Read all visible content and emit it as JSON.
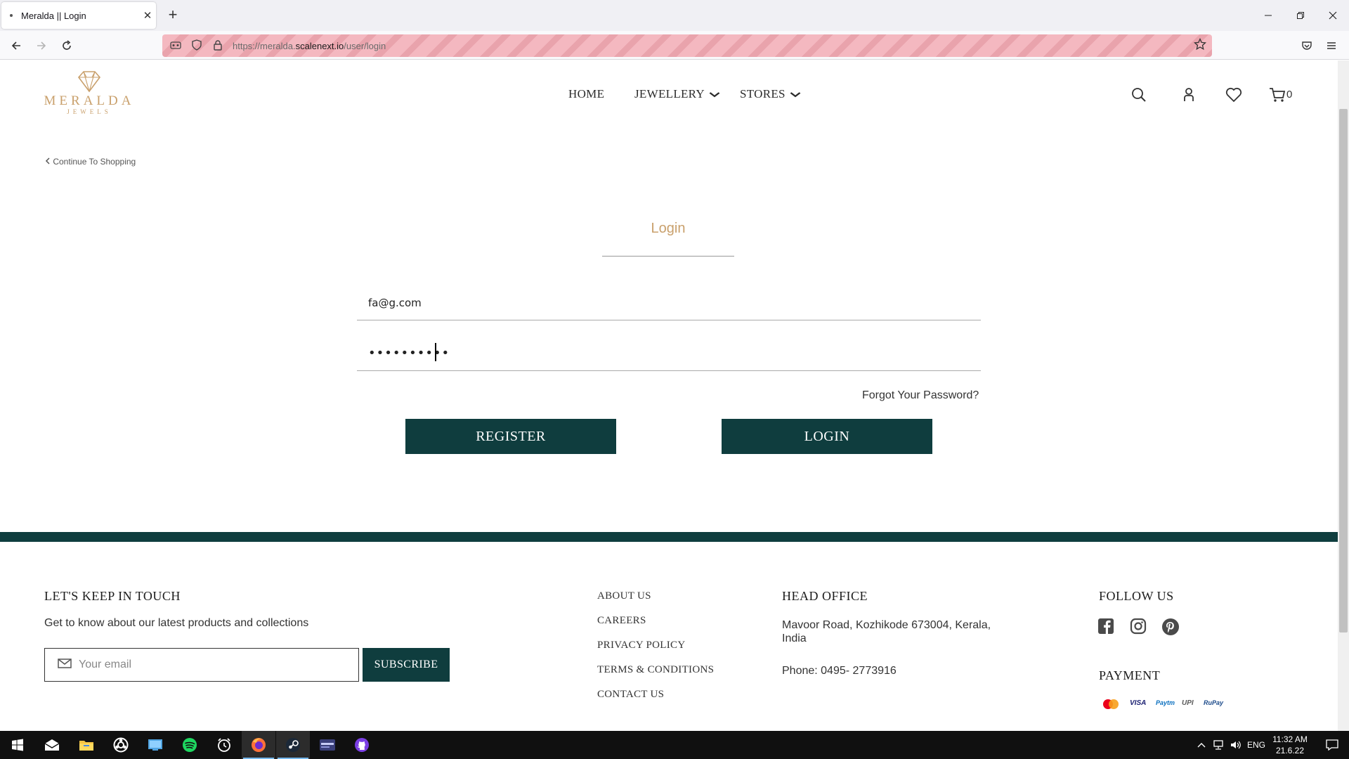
{
  "browser": {
    "tab_title": "Meralda || Login",
    "tab_close": "✕",
    "new_tab": "+",
    "url_prefix": "https://meralda.",
    "url_domain": "scalenext.io",
    "url_path": "/user/login"
  },
  "header": {
    "logo_name": "MERALDA",
    "logo_sub": "JEWELS",
    "nav": [
      {
        "label": "HOME"
      },
      {
        "label": "JEWELLERY"
      },
      {
        "label": "STORES"
      }
    ],
    "cart_count": "0"
  },
  "page": {
    "continue_link": "Continue To Shopping",
    "login_title": "Login",
    "email_value": "fa@g.com",
    "password_value": "••••••••••",
    "forgot_link": "Forgot Your Password?",
    "register_button": "REGISTER",
    "login_button": "LOGIN"
  },
  "footer": {
    "touch_heading": "LET'S KEEP IN TOUCH",
    "touch_text": "Get to know about our latest products and collections",
    "email_placeholder": "Your email",
    "subscribe_button": "SUBSCRIBE",
    "links": [
      "ABOUT US",
      "CAREERS",
      "PRIVACY POLICY",
      "TERMS & CONDITIONS",
      "CONTACT US"
    ],
    "office_heading": "HEAD OFFICE",
    "office_address": "Mavoor Road, Kozhikode 673004, Kerala, India",
    "office_phone": "Phone: 0495- 2773916",
    "follow_heading": "FOLLOW US",
    "payment_heading": "PAYMENT",
    "payments": [
      "VISA",
      "Paytm",
      "UPI",
      "RuPay"
    ]
  },
  "taskbar": {
    "lang": "ENG",
    "time": "11:32 AM",
    "date": "21.6.22"
  },
  "colors": {
    "brand_green": "#0f3d3e",
    "gold": "#c9a06c"
  }
}
